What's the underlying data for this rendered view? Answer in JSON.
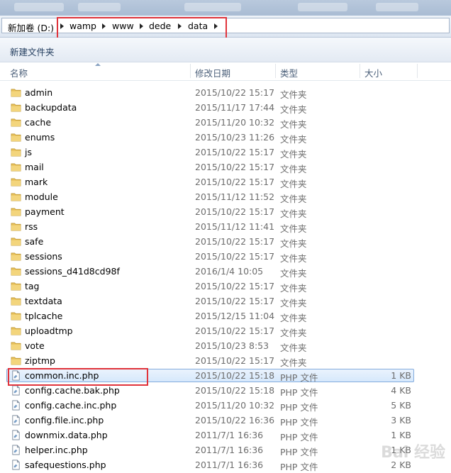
{
  "address_bar": {
    "crumbs": [
      "新加卷 (D:)",
      "wamp",
      "www",
      "dede",
      "data"
    ]
  },
  "toolbar": {
    "new_folder_label": "新建文件夹"
  },
  "columns": {
    "name": "名称",
    "date": "修改日期",
    "type": "类型",
    "size": "大小"
  },
  "rows": [
    {
      "name": "admin",
      "date": "2015/10/22 15:17",
      "type": "文件夹",
      "size": "",
      "kind": "folder"
    },
    {
      "name": "backupdata",
      "date": "2015/11/17 17:44",
      "type": "文件夹",
      "size": "",
      "kind": "folder"
    },
    {
      "name": "cache",
      "date": "2015/11/20 10:32",
      "type": "文件夹",
      "size": "",
      "kind": "folder"
    },
    {
      "name": "enums",
      "date": "2015/10/23 11:26",
      "type": "文件夹",
      "size": "",
      "kind": "folder"
    },
    {
      "name": "js",
      "date": "2015/10/22 15:17",
      "type": "文件夹",
      "size": "",
      "kind": "folder"
    },
    {
      "name": "mail",
      "date": "2015/10/22 15:17",
      "type": "文件夹",
      "size": "",
      "kind": "folder"
    },
    {
      "name": "mark",
      "date": "2015/10/22 15:17",
      "type": "文件夹",
      "size": "",
      "kind": "folder"
    },
    {
      "name": "module",
      "date": "2015/11/12 11:52",
      "type": "文件夹",
      "size": "",
      "kind": "folder"
    },
    {
      "name": "payment",
      "date": "2015/10/22 15:17",
      "type": "文件夹",
      "size": "",
      "kind": "folder"
    },
    {
      "name": "rss",
      "date": "2015/11/12 11:41",
      "type": "文件夹",
      "size": "",
      "kind": "folder"
    },
    {
      "name": "safe",
      "date": "2015/10/22 15:17",
      "type": "文件夹",
      "size": "",
      "kind": "folder"
    },
    {
      "name": "sessions",
      "date": "2015/10/22 15:17",
      "type": "文件夹",
      "size": "",
      "kind": "folder"
    },
    {
      "name": "sessions_d41d8cd98f",
      "date": "2016/1/4 10:05",
      "type": "文件夹",
      "size": "",
      "kind": "folder"
    },
    {
      "name": "tag",
      "date": "2015/10/22 15:17",
      "type": "文件夹",
      "size": "",
      "kind": "folder"
    },
    {
      "name": "textdata",
      "date": "2015/10/22 15:17",
      "type": "文件夹",
      "size": "",
      "kind": "folder"
    },
    {
      "name": "tplcache",
      "date": "2015/12/15 11:04",
      "type": "文件夹",
      "size": "",
      "kind": "folder"
    },
    {
      "name": "uploadtmp",
      "date": "2015/10/22 15:17",
      "type": "文件夹",
      "size": "",
      "kind": "folder"
    },
    {
      "name": "vote",
      "date": "2015/10/23 8:53",
      "type": "文件夹",
      "size": "",
      "kind": "folder"
    },
    {
      "name": "ziptmp",
      "date": "2015/10/22 15:17",
      "type": "文件夹",
      "size": "",
      "kind": "folder"
    },
    {
      "name": "common.inc.php",
      "date": "2015/10/22 15:18",
      "type": "PHP 文件",
      "size": "1 KB",
      "kind": "file",
      "selected": true
    },
    {
      "name": "config.cache.bak.php",
      "date": "2015/10/22 15:18",
      "type": "PHP 文件",
      "size": "4 KB",
      "kind": "file"
    },
    {
      "name": "config.cache.inc.php",
      "date": "2015/11/20 10:32",
      "type": "PHP 文件",
      "size": "5 KB",
      "kind": "file"
    },
    {
      "name": "config.file.inc.php",
      "date": "2015/10/22 16:36",
      "type": "PHP 文件",
      "size": "3 KB",
      "kind": "file"
    },
    {
      "name": "downmix.data.php",
      "date": "2011/7/1 16:36",
      "type": "PHP 文件",
      "size": "1 KB",
      "kind": "file"
    },
    {
      "name": "helper.inc.php",
      "date": "2011/7/1 16:36",
      "type": "PHP 文件",
      "size": "1 KB",
      "kind": "file"
    },
    {
      "name": "safequestions.php",
      "date": "2011/7/1 16:36",
      "type": "PHP 文件",
      "size": "2 KB",
      "kind": "file"
    }
  ],
  "icons": {
    "folder": "folder-icon",
    "file": "php-file-icon",
    "separator": "chevron-right-icon"
  },
  "colors": {
    "highlight": "#e0333b",
    "selection_border": "#84acdd",
    "folder": "#e8c15a"
  },
  "watermark": "Bai 经验"
}
